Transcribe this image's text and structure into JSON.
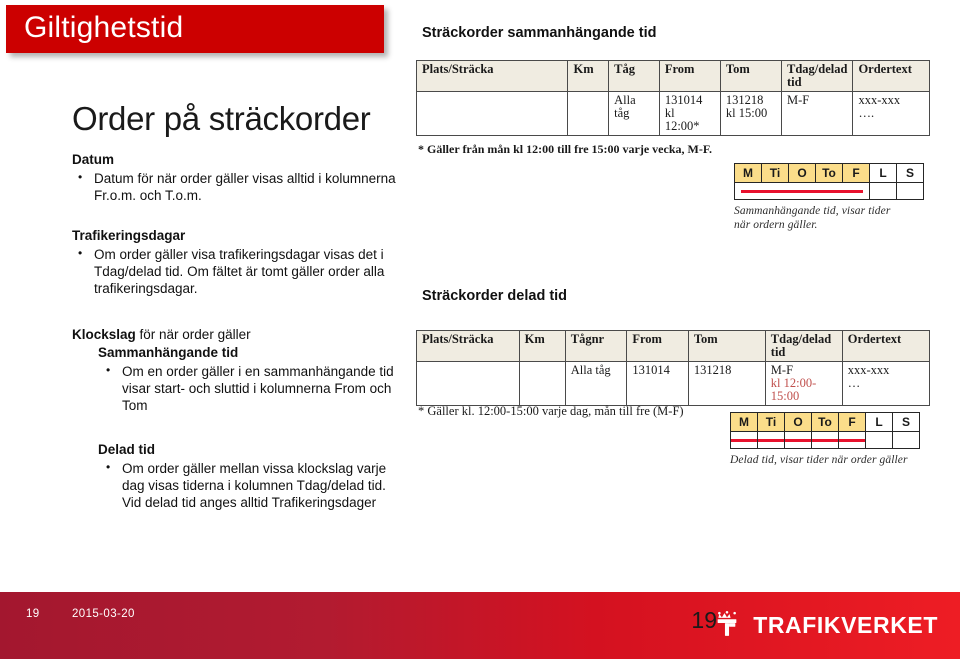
{
  "header": {
    "title": "Giltighetstid"
  },
  "left": {
    "main_heading": "Order på sträckorder",
    "section_datum": {
      "heading": "Datum",
      "bullets": [
        "Datum för när order gäller visas alltid i kolumnerna Fr.o.m. och T.o.m."
      ]
    },
    "section_trafikeringsdagar": {
      "heading": "Trafikeringsdagar",
      "bullets": [
        "Om order gäller visa trafikeringsdagar visas det i Tdag/delad tid. Om fältet är tomt gäller order alla trafikeringsdagar."
      ]
    },
    "section_klockslag": {
      "heading_strong": "Klockslag",
      "heading_rest": " för när order gäller",
      "sub_sammanhangande": {
        "heading": "Sammanhängande tid",
        "bullets": [
          "Om en order gäller i en sammanhängande tid visar start- och sluttid i kolumnerna From och Tom"
        ]
      },
      "sub_delad": {
        "heading": "Delad tid",
        "bullets": [
          "Om order gäller mellan vissa klockslag varje dag visas tiderna i kolumnen Tdag/delad tid. Vid delad tid anges alltid Trafikeringsdager"
        ]
      }
    }
  },
  "right": {
    "table1": {
      "heading": "Sträckorder sammanhängande tid",
      "columns": [
        "Plats/Sträcka",
        "Km",
        "Tåg",
        "From",
        "Tom",
        "Tdag/delad tid",
        "Ordertext"
      ],
      "row": {
        "plats": "",
        "km": "",
        "tag": "Alla tåg",
        "from_l1": "131014",
        "from_l2": "kl",
        "from_l3": "12:00*",
        "tom_l1": "131218",
        "tom_l2": "kl 15:00",
        "tdag": "M-F",
        "order_l1": "xxx-xxx",
        "order_l2": "…."
      },
      "footnote": "* Gäller från mån kl 12:00 till fre 15:00 varje vecka, M-F.",
      "days": {
        "labels": [
          "M",
          "Ti",
          "O",
          "To",
          "F",
          "L",
          "S"
        ],
        "active": [
          true,
          true,
          true,
          true,
          true,
          false,
          false
        ],
        "mark_style": "continuous",
        "caption_l1": "Sammanhängande tid, visar tider",
        "caption_l2": "när ordern gäller."
      }
    },
    "table2": {
      "heading": "Sträckorder delad tid",
      "columns": [
        "Plats/Sträcka",
        "Km",
        "Tågnr",
        "From",
        "Tom",
        "Tdag/delad tid",
        "Ordertext"
      ],
      "row": {
        "plats": "",
        "km": "",
        "tag": "Alla tåg",
        "from": "131014",
        "tom": "131218",
        "tdag_l1": "M-F",
        "tdag_l2": "kl 12:00-",
        "tdag_l3": "15:00",
        "order_l1": "xxx-xxx",
        "order_l2": "…"
      },
      "footnote": "* Gäller kl. 12:00-15:00 varje dag, mån till fre (M-F)",
      "days": {
        "labels": [
          "M",
          "Ti",
          "O",
          "To",
          "F",
          "L",
          "S"
        ],
        "active": [
          true,
          true,
          true,
          true,
          true,
          false,
          false
        ],
        "mark_style": "segmented",
        "caption_l1": "Delad tid, visar tider när order gäller",
        "caption_l2": ""
      }
    }
  },
  "footer": {
    "page_number": "19",
    "date": "2015-03-20",
    "slide_number": "19",
    "brand": "TRAFIKVERKET"
  },
  "colors": {
    "brand_red": "#cc0000",
    "footer_red_left": "#a3172f",
    "footer_red_right": "#ee1d24",
    "day_active": "#fbdd8a",
    "mark_red": "#e8112d",
    "table_header_bg": "#f0ece1",
    "cell_red_text": "#c0504d"
  }
}
